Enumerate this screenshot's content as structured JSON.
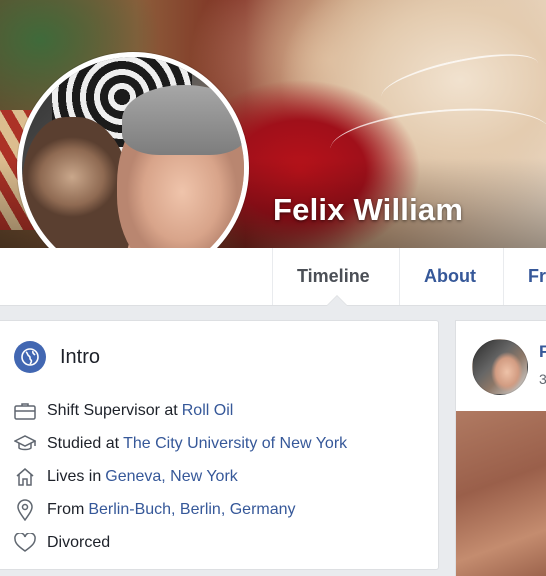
{
  "profile": {
    "name": "Felix William"
  },
  "nav": {
    "tabs": [
      {
        "label": "Timeline",
        "active": true
      },
      {
        "label": "About",
        "active": false
      },
      {
        "label": "Fr",
        "active": false
      }
    ]
  },
  "intro": {
    "title": "Intro",
    "items": [
      {
        "icon": "briefcase-icon",
        "prefix": "Shift Supervisor at",
        "link": "Roll Oil"
      },
      {
        "icon": "graduation-cap-icon",
        "prefix": "Studied at",
        "link": "The City University of New York"
      },
      {
        "icon": "home-icon",
        "prefix": "Lives in",
        "link": "Geneva, New York"
      },
      {
        "icon": "location-pin-icon",
        "prefix": "From",
        "link": "Berlin-Buch, Berlin, Germany"
      },
      {
        "icon": "heart-icon",
        "prefix": "Divorced",
        "link": ""
      }
    ]
  },
  "post": {
    "author_initial": "F",
    "time_partial": "3"
  },
  "colors": {
    "link": "#365899",
    "accent": "#4267b2",
    "text": "#1d2129",
    "background": "#e9ebee"
  }
}
